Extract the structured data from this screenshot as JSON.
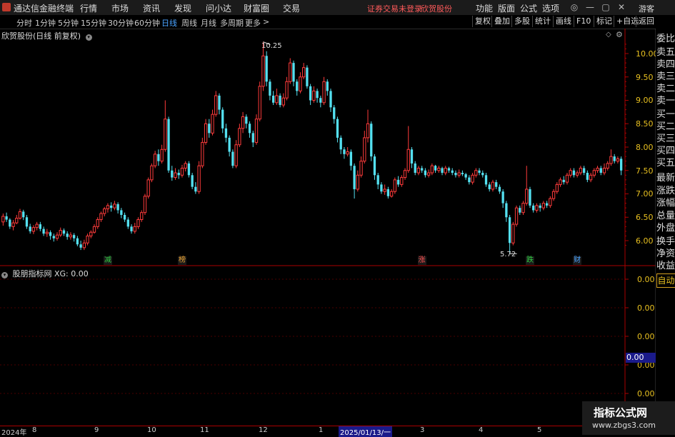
{
  "menubar": {
    "app_title": "通达信金融终端",
    "items": [
      "行情",
      "市场",
      "资讯",
      "发现",
      "问小达",
      "财富圈",
      "交易"
    ],
    "warning": "证券交易未登录",
    "stock_name": "欣贺股份",
    "right_items": [
      "功能",
      "版面",
      "公式",
      "选项"
    ],
    "guest": "游客"
  },
  "toolbar": {
    "periods": [
      "分时",
      "1分钟",
      "5分钟",
      "15分钟",
      "30分钟",
      "60分钟",
      "日线",
      "周线",
      "月线",
      "多周期",
      "更多"
    ],
    "active_period": "日线",
    "right_buttons": [
      "复权",
      "叠加",
      "多股",
      "统计",
      "画线",
      "F10",
      "标记",
      "+自选",
      "返回"
    ]
  },
  "chart": {
    "title": "欣贺股份(日线 前复权)",
    "high_label": "10.25",
    "low_label": "5.72",
    "y_ticks": [
      "10.00",
      "9.50",
      "9.00",
      "8.50",
      "8.00",
      "7.50",
      "7.00",
      "6.50",
      "6.00"
    ],
    "markers": [
      {
        "text": "减",
        "color": "#2ecc40"
      },
      {
        "text": "榜",
        "color": "#e8a030"
      },
      {
        "text": "涨",
        "color": "#ff5050"
      },
      {
        "text": "跌",
        "color": "#2ecc40"
      },
      {
        "text": "财",
        "color": "#4aa3ff"
      }
    ]
  },
  "indicator": {
    "title": "股朋指标网 XG: 0.00",
    "y_ticks": [
      "0.00",
      "0.00",
      "0.00",
      "0.00",
      "0.00"
    ],
    "current_value": "0.00"
  },
  "side_panel": {
    "items": [
      "委比",
      "卖五",
      "卖四",
      "卖三",
      "卖二",
      "卖一",
      "买一",
      "买二",
      "买三",
      "买四",
      "买五",
      "最新",
      "涨跌",
      "涨幅",
      "总量",
      "外盘",
      "换手",
      "净资",
      "收益"
    ],
    "auto_button": "自动"
  },
  "date_axis": [
    "2024年",
    "8",
    "9",
    "10",
    "11",
    "12",
    "1",
    "2025/01/13/一",
    "3",
    "4",
    "5"
  ],
  "watermark": {
    "line1": "指标公式网",
    "line2": "www.zbgs3.com"
  },
  "chart_data": {
    "type": "candlestick",
    "title": "欣贺股份(日线 前复权)",
    "ylim": [
      5.55,
      10.35
    ],
    "up_color": "#ff3b3b",
    "down_color": "#54e0f0",
    "high": 10.25,
    "low": 5.72,
    "candles": [
      [
        6.4,
        6.52,
        6.58,
        6.32
      ],
      [
        6.52,
        6.45,
        6.6,
        6.4
      ],
      [
        6.45,
        6.3,
        6.48,
        6.25
      ],
      [
        6.3,
        6.38,
        6.44,
        6.22
      ],
      [
        6.38,
        6.48,
        6.55,
        6.35
      ],
      [
        6.48,
        6.62,
        6.68,
        6.45
      ],
      [
        6.62,
        6.5,
        6.66,
        6.44
      ],
      [
        6.5,
        6.3,
        6.55,
        6.25
      ],
      [
        6.3,
        6.2,
        6.36,
        6.15
      ],
      [
        6.2,
        6.28,
        6.33,
        6.14
      ],
      [
        6.28,
        6.35,
        6.4,
        6.22
      ],
      [
        6.35,
        6.25,
        6.4,
        6.2
      ],
      [
        6.25,
        6.15,
        6.3,
        6.1
      ],
      [
        6.15,
        6.18,
        6.25,
        6.08
      ],
      [
        6.18,
        6.1,
        6.22,
        6.02
      ],
      [
        6.1,
        6.05,
        6.15,
        5.98
      ],
      [
        6.05,
        6.12,
        6.18,
        6.0
      ],
      [
        6.12,
        6.22,
        6.28,
        6.08
      ],
      [
        6.22,
        6.15,
        6.26,
        6.1
      ],
      [
        6.15,
        6.08,
        6.2,
        6.02
      ],
      [
        6.08,
        6.12,
        6.18,
        6.02
      ],
      [
        6.12,
        6.05,
        6.16,
        5.98
      ],
      [
        6.05,
        5.92,
        6.1,
        5.88
      ],
      [
        5.92,
        5.85,
        6.0,
        5.8
      ],
      [
        5.85,
        5.95,
        6.02,
        5.8
      ],
      [
        5.95,
        6.1,
        6.15,
        5.9
      ],
      [
        6.1,
        6.18,
        6.22,
        6.05
      ],
      [
        6.18,
        6.3,
        6.35,
        6.15
      ],
      [
        6.3,
        6.45,
        6.5,
        6.25
      ],
      [
        6.45,
        6.58,
        6.62,
        6.4
      ],
      [
        6.58,
        6.68,
        6.72,
        6.52
      ],
      [
        6.68,
        6.75,
        6.8,
        6.6
      ],
      [
        6.75,
        6.7,
        6.82,
        6.62
      ],
      [
        6.7,
        6.78,
        6.85,
        6.65
      ],
      [
        6.78,
        6.65,
        6.82,
        6.58
      ],
      [
        6.65,
        6.55,
        6.7,
        6.48
      ],
      [
        6.55,
        6.45,
        6.6,
        6.4
      ],
      [
        6.45,
        6.3,
        6.5,
        6.25
      ],
      [
        6.3,
        6.2,
        6.35,
        6.15
      ],
      [
        6.2,
        6.3,
        6.38,
        6.15
      ],
      [
        6.3,
        6.45,
        6.5,
        6.25
      ],
      [
        6.45,
        6.6,
        6.65,
        6.4
      ],
      [
        6.6,
        6.95,
        7.0,
        6.55
      ],
      [
        6.95,
        7.3,
        7.35,
        6.9
      ],
      [
        7.3,
        7.6,
        7.65,
        7.25
      ],
      [
        7.6,
        7.85,
        7.92,
        7.55
      ],
      [
        7.85,
        7.7,
        7.95,
        7.6
      ],
      [
        7.7,
        7.95,
        8.05,
        7.65
      ],
      [
        7.95,
        8.6,
        9.0,
        7.9
      ],
      [
        8.6,
        7.5,
        8.65,
        7.45
      ],
      [
        7.5,
        7.35,
        7.6,
        7.28
      ],
      [
        7.35,
        7.45,
        7.55,
        7.3
      ],
      [
        7.45,
        7.4,
        7.52,
        7.32
      ],
      [
        7.4,
        7.55,
        7.62,
        7.35
      ],
      [
        7.55,
        7.65,
        7.7,
        7.48
      ],
      [
        7.65,
        7.4,
        7.7,
        7.35
      ],
      [
        7.4,
        7.15,
        7.45,
        7.1
      ],
      [
        7.15,
        7.05,
        7.25,
        7.0
      ],
      [
        7.05,
        7.6,
        7.7,
        7.0
      ],
      [
        7.6,
        8.1,
        8.2,
        7.55
      ],
      [
        8.1,
        8.5,
        8.6,
        8.05
      ],
      [
        8.5,
        8.3,
        8.6,
        8.2
      ],
      [
        8.3,
        8.7,
        8.8,
        8.25
      ],
      [
        8.7,
        9.1,
        9.2,
        8.65
      ],
      [
        9.1,
        8.8,
        9.15,
        8.7
      ],
      [
        8.8,
        8.4,
        8.85,
        8.3
      ],
      [
        8.4,
        8.2,
        8.5,
        8.1
      ],
      [
        8.2,
        7.9,
        8.25,
        7.8
      ],
      [
        7.9,
        7.6,
        7.95,
        7.55
      ],
      [
        7.6,
        8.05,
        8.15,
        7.55
      ],
      [
        8.05,
        8.4,
        8.5,
        8.0
      ],
      [
        8.4,
        8.65,
        8.75,
        8.3
      ],
      [
        8.65,
        8.5,
        8.7,
        8.4
      ],
      [
        8.5,
        8.3,
        8.55,
        8.2
      ],
      [
        8.3,
        8.1,
        8.35,
        8.0
      ],
      [
        8.1,
        8.6,
        8.7,
        8.05
      ],
      [
        8.6,
        9.3,
        9.4,
        8.55
      ],
      [
        9.3,
        9.95,
        10.25,
        9.2
      ],
      [
        9.95,
        9.4,
        10.05,
        9.3
      ],
      [
        9.4,
        9.1,
        9.45,
        9.0
      ],
      [
        9.1,
        8.95,
        9.2,
        8.9
      ],
      [
        8.95,
        9.1,
        9.25,
        8.9
      ],
      [
        9.1,
        8.9,
        9.15,
        8.85
      ],
      [
        8.9,
        9.05,
        9.15,
        8.85
      ],
      [
        9.05,
        9.4,
        9.5,
        9.0
      ],
      [
        9.4,
        9.8,
        9.9,
        9.35
      ],
      [
        9.8,
        9.4,
        9.85,
        9.3
      ],
      [
        9.4,
        9.2,
        9.45,
        9.1
      ],
      [
        9.2,
        9.5,
        9.6,
        9.15
      ],
      [
        9.5,
        9.7,
        9.8,
        9.45
      ],
      [
        9.7,
        9.3,
        9.75,
        9.25
      ],
      [
        9.3,
        9.0,
        9.35,
        8.9
      ],
      [
        9.0,
        9.2,
        9.3,
        8.95
      ],
      [
        9.2,
        9.05,
        9.25,
        8.95
      ],
      [
        9.05,
        8.95,
        9.1,
        8.85
      ],
      [
        8.95,
        9.4,
        9.5,
        8.9
      ],
      [
        9.4,
        9.2,
        9.45,
        9.1
      ],
      [
        9.2,
        8.85,
        9.25,
        8.75
      ],
      [
        8.85,
        8.6,
        8.9,
        8.5
      ],
      [
        8.6,
        8.2,
        8.65,
        8.1
      ],
      [
        8.2,
        7.95,
        8.25,
        7.85
      ],
      [
        7.95,
        7.85,
        8.0,
        7.75
      ],
      [
        7.85,
        7.9,
        8.0,
        7.8
      ],
      [
        7.9,
        7.6,
        7.95,
        7.5
      ],
      [
        7.6,
        7.1,
        7.65,
        6.9
      ],
      [
        7.1,
        7.4,
        7.5,
        7.05
      ],
      [
        7.4,
        7.7,
        7.8,
        7.35
      ],
      [
        7.7,
        8.2,
        8.35,
        7.65
      ],
      [
        8.2,
        8.5,
        8.8,
        8.1
      ],
      [
        8.5,
        7.8,
        8.55,
        7.7
      ],
      [
        7.8,
        7.4,
        7.85,
        7.3
      ],
      [
        7.4,
        7.2,
        7.45,
        7.1
      ],
      [
        7.2,
        7.05,
        7.25,
        7.0
      ],
      [
        7.05,
        7.1,
        7.2,
        6.98
      ],
      [
        7.1,
        6.95,
        7.15,
        6.9
      ],
      [
        6.95,
        7.05,
        7.1,
        6.92
      ],
      [
        7.05,
        7.3,
        7.35,
        7.0
      ],
      [
        7.3,
        7.2,
        7.38,
        7.15
      ],
      [
        7.2,
        7.35,
        7.4,
        7.15
      ],
      [
        7.35,
        7.5,
        7.55,
        7.3
      ],
      [
        7.5,
        7.95,
        8.45,
        7.45
      ],
      [
        7.95,
        7.65,
        8.0,
        7.55
      ],
      [
        7.65,
        7.45,
        7.7,
        7.4
      ],
      [
        7.45,
        7.55,
        7.6,
        7.4
      ],
      [
        7.55,
        7.5,
        7.6,
        7.45
      ],
      [
        7.5,
        7.4,
        7.55,
        7.35
      ],
      [
        7.4,
        7.45,
        7.52,
        7.35
      ],
      [
        7.45,
        7.6,
        7.65,
        7.4
      ],
      [
        7.6,
        7.5,
        7.62,
        7.45
      ],
      [
        7.5,
        7.55,
        7.6,
        7.45
      ],
      [
        7.55,
        7.45,
        7.58,
        7.4
      ],
      [
        7.45,
        7.55,
        7.6,
        7.4
      ],
      [
        7.55,
        7.5,
        7.58,
        7.45
      ],
      [
        7.5,
        7.45,
        7.55,
        7.4
      ],
      [
        7.45,
        7.4,
        7.5,
        7.35
      ],
      [
        7.4,
        7.45,
        7.52,
        7.35
      ],
      [
        7.45,
        7.42,
        7.5,
        7.38
      ],
      [
        7.42,
        7.35,
        7.45,
        7.3
      ],
      [
        7.35,
        7.25,
        7.4,
        7.2
      ],
      [
        7.25,
        7.4,
        7.45,
        7.2
      ],
      [
        7.4,
        7.5,
        7.55,
        7.35
      ],
      [
        7.5,
        7.45,
        7.55,
        7.4
      ],
      [
        7.45,
        7.4,
        7.5,
        7.35
      ],
      [
        7.4,
        7.2,
        7.45,
        7.15
      ],
      [
        7.2,
        7.1,
        7.25,
        7.05
      ],
      [
        7.1,
        7.25,
        7.3,
        7.05
      ],
      [
        7.25,
        7.15,
        7.3,
        7.1
      ],
      [
        7.15,
        7.05,
        7.2,
        7.0
      ],
      [
        7.05,
        6.8,
        7.1,
        6.7
      ],
      [
        6.8,
        6.5,
        6.85,
        6.4
      ],
      [
        6.5,
        5.95,
        6.55,
        5.72
      ],
      [
        5.95,
        6.35,
        6.4,
        5.9
      ],
      [
        6.35,
        6.7,
        6.75,
        6.3
      ],
      [
        6.7,
        6.6,
        6.75,
        6.55
      ],
      [
        6.6,
        6.8,
        6.85,
        6.55
      ],
      [
        6.8,
        7.1,
        7.6,
        6.75
      ],
      [
        7.1,
        6.75,
        7.15,
        6.7
      ],
      [
        6.75,
        6.65,
        6.8,
        6.6
      ],
      [
        6.65,
        6.75,
        6.8,
        6.6
      ],
      [
        6.75,
        6.7,
        6.8,
        6.62
      ],
      [
        6.7,
        6.8,
        6.85,
        6.65
      ],
      [
        6.8,
        6.75,
        6.85,
        6.7
      ],
      [
        6.75,
        6.9,
        6.95,
        6.7
      ],
      [
        6.9,
        7.05,
        7.1,
        6.85
      ],
      [
        7.05,
        7.2,
        7.25,
        7.0
      ],
      [
        7.2,
        7.3,
        7.35,
        7.15
      ],
      [
        7.3,
        7.25,
        7.38,
        7.2
      ],
      [
        7.25,
        7.4,
        7.45,
        7.2
      ],
      [
        7.4,
        7.5,
        7.55,
        7.35
      ],
      [
        7.5,
        7.4,
        7.55,
        7.35
      ],
      [
        7.4,
        7.45,
        7.5,
        7.35
      ],
      [
        7.45,
        7.55,
        7.6,
        7.4
      ],
      [
        7.55,
        7.45,
        7.6,
        7.4
      ],
      [
        7.45,
        7.3,
        7.5,
        7.25
      ],
      [
        7.3,
        7.4,
        7.45,
        7.25
      ],
      [
        7.4,
        7.5,
        7.55,
        7.35
      ],
      [
        7.5,
        7.55,
        7.6,
        7.45
      ],
      [
        7.55,
        7.45,
        7.6,
        7.4
      ],
      [
        7.45,
        7.55,
        7.65,
        7.4
      ],
      [
        7.55,
        7.65,
        7.7,
        7.5
      ],
      [
        7.65,
        7.8,
        7.95,
        7.6
      ],
      [
        7.8,
        7.7,
        7.85,
        7.65
      ],
      [
        7.7,
        7.75,
        7.8,
        7.65
      ],
      [
        7.75,
        7.5,
        7.8,
        7.4
      ]
    ],
    "markers_at": [
      31,
      53,
      124,
      156,
      170
    ]
  }
}
